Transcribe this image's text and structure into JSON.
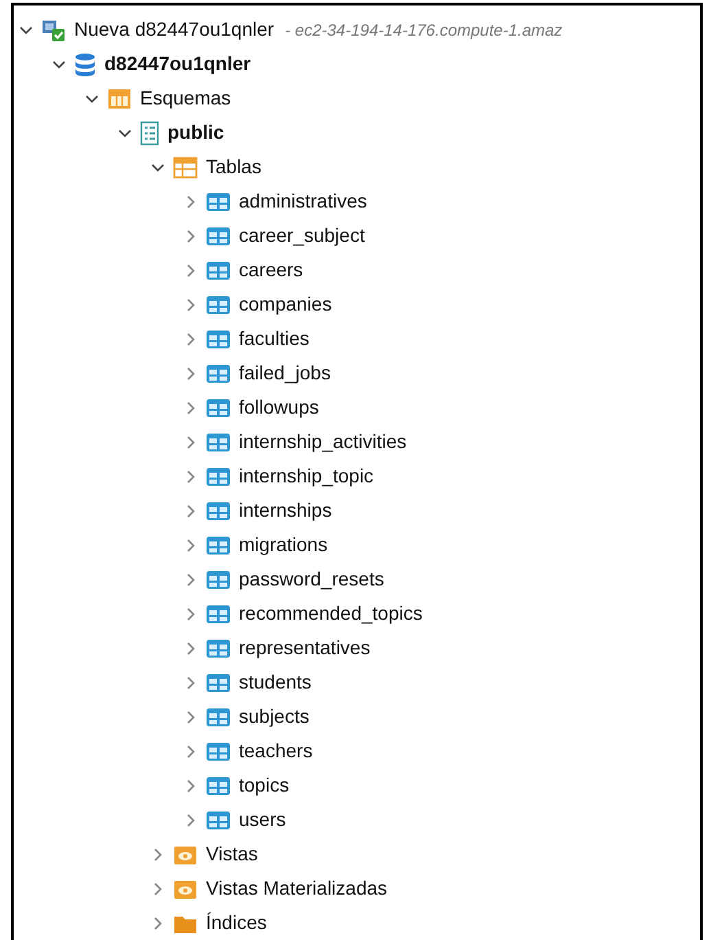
{
  "tree": [
    {
      "kind": "connection",
      "label": "Nueva d82447ou1qnler",
      "subtitle": "- ec2-34-194-14-176.compute-1.amaz",
      "expanded": true,
      "children": [
        {
          "kind": "database",
          "label": "d82447ou1qnler",
          "expanded": true,
          "children": [
            {
              "kind": "schemas",
              "label": "Esquemas",
              "expanded": true,
              "children": [
                {
                  "kind": "schema",
                  "label": "public",
                  "expanded": true,
                  "children": [
                    {
                      "kind": "tables",
                      "label": "Tablas",
                      "expanded": true,
                      "children": [
                        {
                          "kind": "table",
                          "label": "administratives",
                          "expanded": false
                        },
                        {
                          "kind": "table",
                          "label": "career_subject",
                          "expanded": false
                        },
                        {
                          "kind": "table",
                          "label": "careers",
                          "expanded": false
                        },
                        {
                          "kind": "table",
                          "label": "companies",
                          "expanded": false
                        },
                        {
                          "kind": "table",
                          "label": "faculties",
                          "expanded": false
                        },
                        {
                          "kind": "table",
                          "label": "failed_jobs",
                          "expanded": false
                        },
                        {
                          "kind": "table",
                          "label": "followups",
                          "expanded": false
                        },
                        {
                          "kind": "table",
                          "label": "internship_activities",
                          "expanded": false
                        },
                        {
                          "kind": "table",
                          "label": "internship_topic",
                          "expanded": false
                        },
                        {
                          "kind": "table",
                          "label": "internships",
                          "expanded": false
                        },
                        {
                          "kind": "table",
                          "label": "migrations",
                          "expanded": false
                        },
                        {
                          "kind": "table",
                          "label": "password_resets",
                          "expanded": false
                        },
                        {
                          "kind": "table",
                          "label": "recommended_topics",
                          "expanded": false
                        },
                        {
                          "kind": "table",
                          "label": "representatives",
                          "expanded": false
                        },
                        {
                          "kind": "table",
                          "label": "students",
                          "expanded": false
                        },
                        {
                          "kind": "table",
                          "label": "subjects",
                          "expanded": false
                        },
                        {
                          "kind": "table",
                          "label": "teachers",
                          "expanded": false
                        },
                        {
                          "kind": "table",
                          "label": "topics",
                          "expanded": false
                        },
                        {
                          "kind": "table",
                          "label": "users",
                          "expanded": false
                        }
                      ]
                    },
                    {
                      "kind": "views",
                      "label": "Vistas",
                      "expanded": false
                    },
                    {
                      "kind": "matviews",
                      "label": "Vistas Materializadas",
                      "expanded": false
                    },
                    {
                      "kind": "indexes",
                      "label": "Índices",
                      "expanded": false
                    }
                  ]
                }
              ]
            }
          ]
        }
      ]
    }
  ]
}
